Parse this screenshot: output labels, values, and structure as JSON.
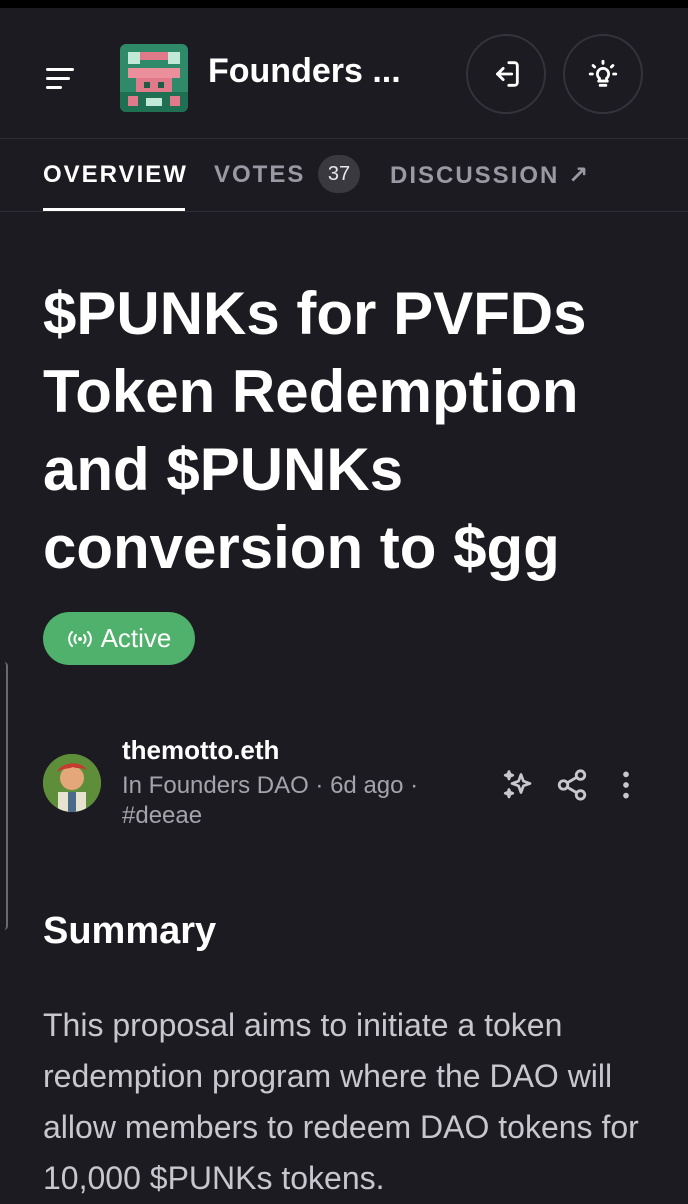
{
  "header": {
    "title": "Founders ...",
    "menu_icon": "menu-icon",
    "logout_icon": "logout-icon",
    "theme_icon": "lightbulb-icon"
  },
  "tabs": [
    {
      "label": "OVERVIEW",
      "active": true
    },
    {
      "label": "VOTES",
      "count": "37",
      "active": false
    },
    {
      "label": "DISCUSSION ↗",
      "active": false
    }
  ],
  "proposal": {
    "title": "$PUNKs for PVFDs Token Redemption and $PUNKs conversion to $gg",
    "status": "Active",
    "status_color": "#4fb16b"
  },
  "author": {
    "name": "themotto.eth",
    "meta": "In Founders DAO · 6d ago · #deeae"
  },
  "actions": {
    "ai_icon": "sparkles-icon",
    "share_icon": "share-icon",
    "more_icon": "more-vertical-icon"
  },
  "summary": {
    "heading": "Summary",
    "text": "This proposal aims to initiate a token redemption program where the DAO will allow members to redeem DAO tokens for 10,000 $PUNKs tokens."
  }
}
